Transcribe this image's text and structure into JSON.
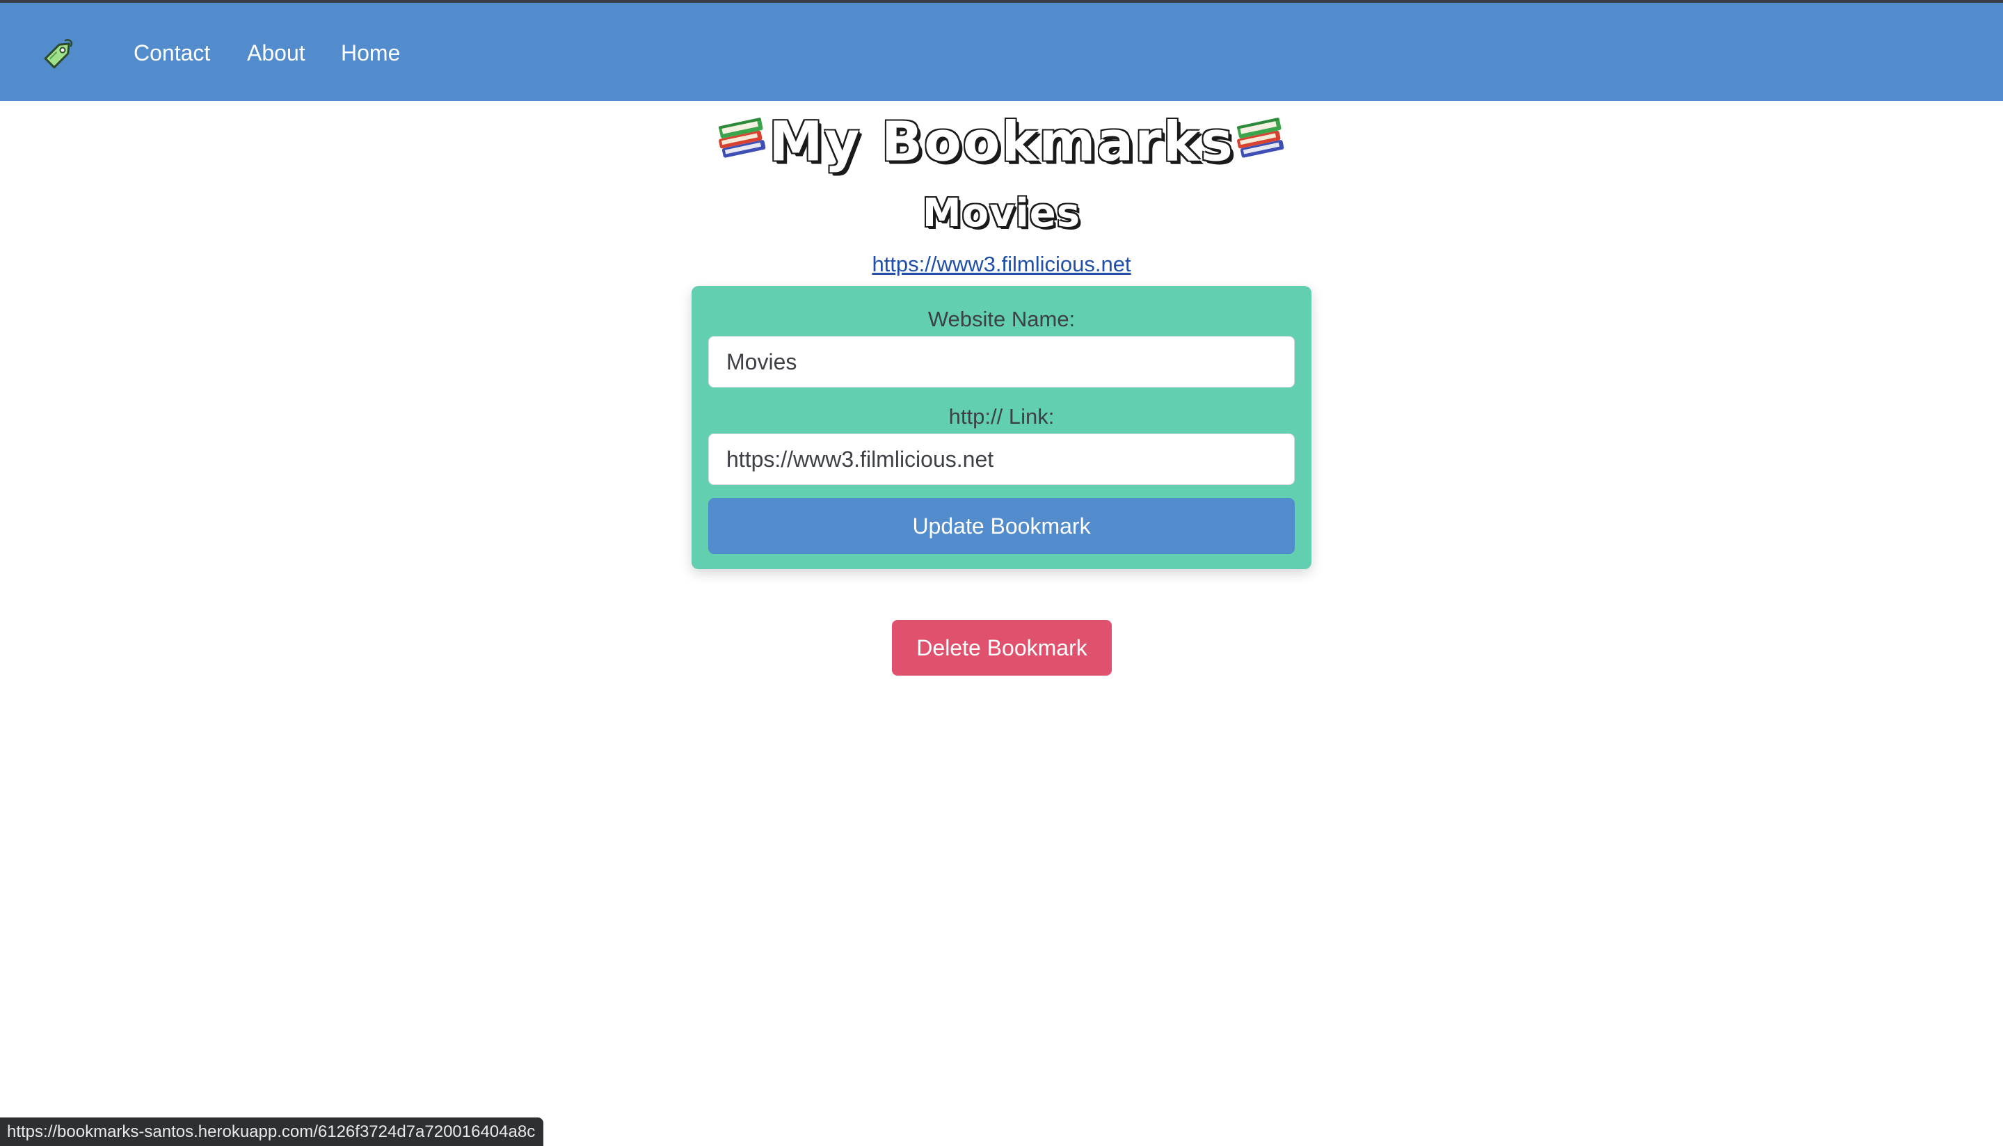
{
  "nav": {
    "logo_icon": "price-tag-icon",
    "links": [
      "Contact",
      "About",
      "Home"
    ]
  },
  "header": {
    "title": "My Bookmarks",
    "title_icon": "books-emoji-icon"
  },
  "bookmark": {
    "name": "Movies",
    "url": "https://www3.filmlicious.net"
  },
  "form": {
    "name_label": "Website Name:",
    "name_value": "Movies",
    "link_label": "http:// Link:",
    "link_value": "https://www3.filmlicious.net",
    "update_label": "Update Bookmark"
  },
  "actions": {
    "delete_label": "Delete Bookmark"
  },
  "status_bar": {
    "url": "https://bookmarks-santos.herokuapp.com/6126f3724d7a720016404a8c"
  },
  "colors": {
    "navbar": "#538ccd",
    "card": "#62cfb1",
    "update_button": "#538ccd",
    "delete_button": "#e0516d",
    "link": "#1f4fa8"
  }
}
